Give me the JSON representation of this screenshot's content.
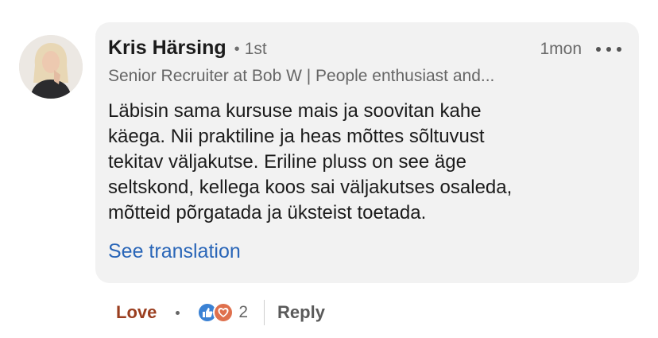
{
  "author": {
    "name": "Kris Härsing",
    "separator": "•",
    "degree": "1st",
    "headline": "Senior Recruiter at Bob W | People enthusiast and..."
  },
  "comment": {
    "time": "1mon",
    "text": "Läbisin sama kursuse mais ja soovitan kahe\nkäega. Nii praktiline ja heas mõttes sõltuvust\ntekitav väljakutse. Eriline pluss on see äge\nseltskond, kellega koos sai väljakutses osaleda,\nmõtteid põrgatada ja üksteist toetada.",
    "see_translation": "See translation"
  },
  "actions": {
    "reaction_label": "Love",
    "separator": "•",
    "reaction_count": "2",
    "reply_label": "Reply"
  },
  "colors": {
    "bubble": "#f2f2f2",
    "link": "#2a66b8",
    "love": "#9a3e1f",
    "like_icon": "#3b82d4",
    "love_icon": "#df704d"
  },
  "icons": [
    "more-options-icon",
    "like-reaction-icon",
    "love-reaction-icon"
  ]
}
